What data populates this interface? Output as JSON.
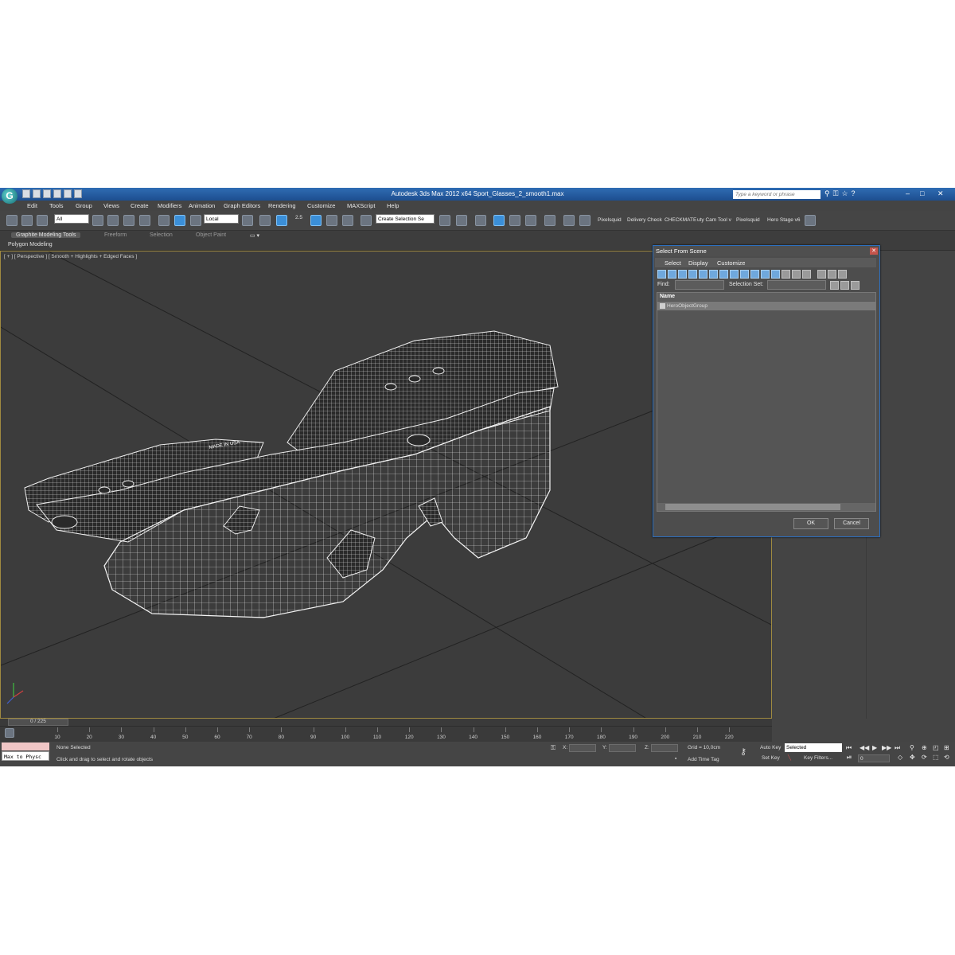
{
  "window": {
    "title": "Autodesk 3ds Max  2012 x64      Sport_Glasses_2_smooth1.max",
    "search_placeholder": "Type a keyword or phrase"
  },
  "menu": [
    "Edit",
    "Tools",
    "Group",
    "Views",
    "Create",
    "Modifiers",
    "Animation",
    "Graph Editors",
    "Rendering",
    "Customize",
    "MAXScript",
    "Help"
  ],
  "toolbar": {
    "filter": "All",
    "coord_system": "Local",
    "snap_value": "2.5",
    "selection_set": "Create Selection Se",
    "custom_items": [
      "Pixelsquid",
      "Delivery Check",
      "CHECKMATE",
      "uty Cam Tool v",
      "Pixelsquid",
      "Hero Stage v6"
    ]
  },
  "ribbon": {
    "tabs": [
      "Graphite Modeling Tools",
      "Freeform",
      "Selection",
      "Object Paint"
    ],
    "subtab": "Polygon Modeling"
  },
  "viewport": {
    "label": "[ + ] [ Perspective ] [ Smooth + Highlights + Edged Faces ]",
    "model_text": "MADE IN USA"
  },
  "dialog": {
    "title": "Select From Scene",
    "menu": [
      "Select",
      "Display",
      "Customize"
    ],
    "find_label": "Find:",
    "selection_set_label": "Selection Set:",
    "column_header": "Name",
    "rows": [
      "HeroObjectGroup"
    ],
    "ok": "OK",
    "cancel": "Cancel"
  },
  "timeline": {
    "frame_label": "0 / 225",
    "ticks": [
      "10",
      "20",
      "30",
      "40",
      "50",
      "60",
      "70",
      "80",
      "90",
      "100",
      "110",
      "120",
      "130",
      "140",
      "150",
      "160",
      "170",
      "180",
      "190",
      "200",
      "210",
      "220"
    ]
  },
  "status": {
    "maxscript": "Max to Physc",
    "selection": "None Selected",
    "prompt": "Click and drag to select and rotate objects",
    "x_label": "X:",
    "y_label": "Y:",
    "z_label": "Z:",
    "grid": "Grid = 10,0cm",
    "add_time_tag": "Add Time Tag",
    "auto_key": "Auto Key",
    "set_key": "Set Key",
    "key_mode": "Selected",
    "key_filters": "Key Filters...",
    "frame": "0"
  },
  "colors": {
    "title_bar": "#2f6cb3",
    "viewport_bg": "#3c3c3c",
    "active_border": "#a08a40",
    "dialog_border": "#2b6fc0"
  }
}
